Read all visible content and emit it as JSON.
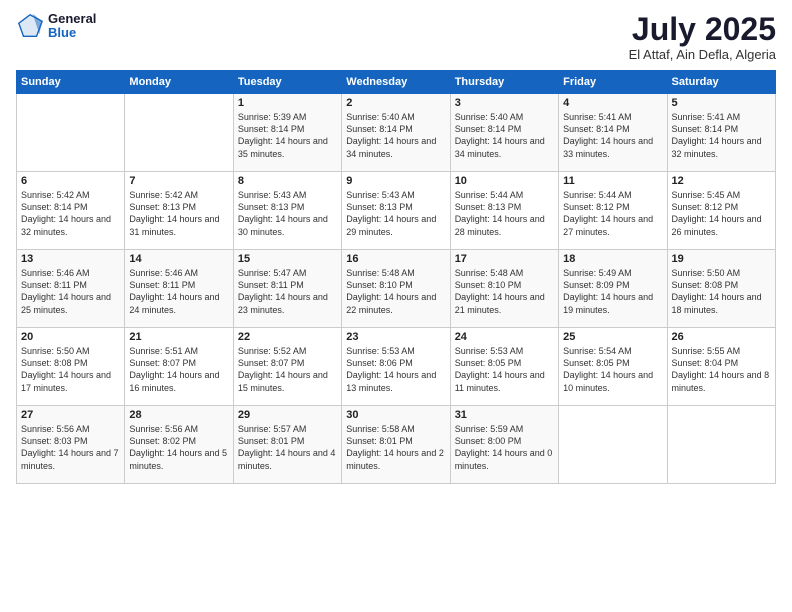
{
  "header": {
    "logo_general": "General",
    "logo_blue": "Blue",
    "month_title": "July 2025",
    "location": "El Attaf, Ain Defla, Algeria"
  },
  "weekdays": [
    "Sunday",
    "Monday",
    "Tuesday",
    "Wednesday",
    "Thursday",
    "Friday",
    "Saturday"
  ],
  "weeks": [
    [
      {
        "day": "",
        "sunrise": "",
        "sunset": "",
        "daylight": ""
      },
      {
        "day": "",
        "sunrise": "",
        "sunset": "",
        "daylight": ""
      },
      {
        "day": "1",
        "sunrise": "Sunrise: 5:39 AM",
        "sunset": "Sunset: 8:14 PM",
        "daylight": "Daylight: 14 hours and 35 minutes."
      },
      {
        "day": "2",
        "sunrise": "Sunrise: 5:40 AM",
        "sunset": "Sunset: 8:14 PM",
        "daylight": "Daylight: 14 hours and 34 minutes."
      },
      {
        "day": "3",
        "sunrise": "Sunrise: 5:40 AM",
        "sunset": "Sunset: 8:14 PM",
        "daylight": "Daylight: 14 hours and 34 minutes."
      },
      {
        "day": "4",
        "sunrise": "Sunrise: 5:41 AM",
        "sunset": "Sunset: 8:14 PM",
        "daylight": "Daylight: 14 hours and 33 minutes."
      },
      {
        "day": "5",
        "sunrise": "Sunrise: 5:41 AM",
        "sunset": "Sunset: 8:14 PM",
        "daylight": "Daylight: 14 hours and 32 minutes."
      }
    ],
    [
      {
        "day": "6",
        "sunrise": "Sunrise: 5:42 AM",
        "sunset": "Sunset: 8:14 PM",
        "daylight": "Daylight: 14 hours and 32 minutes."
      },
      {
        "day": "7",
        "sunrise": "Sunrise: 5:42 AM",
        "sunset": "Sunset: 8:13 PM",
        "daylight": "Daylight: 14 hours and 31 minutes."
      },
      {
        "day": "8",
        "sunrise": "Sunrise: 5:43 AM",
        "sunset": "Sunset: 8:13 PM",
        "daylight": "Daylight: 14 hours and 30 minutes."
      },
      {
        "day": "9",
        "sunrise": "Sunrise: 5:43 AM",
        "sunset": "Sunset: 8:13 PM",
        "daylight": "Daylight: 14 hours and 29 minutes."
      },
      {
        "day": "10",
        "sunrise": "Sunrise: 5:44 AM",
        "sunset": "Sunset: 8:13 PM",
        "daylight": "Daylight: 14 hours and 28 minutes."
      },
      {
        "day": "11",
        "sunrise": "Sunrise: 5:44 AM",
        "sunset": "Sunset: 8:12 PM",
        "daylight": "Daylight: 14 hours and 27 minutes."
      },
      {
        "day": "12",
        "sunrise": "Sunrise: 5:45 AM",
        "sunset": "Sunset: 8:12 PM",
        "daylight": "Daylight: 14 hours and 26 minutes."
      }
    ],
    [
      {
        "day": "13",
        "sunrise": "Sunrise: 5:46 AM",
        "sunset": "Sunset: 8:11 PM",
        "daylight": "Daylight: 14 hours and 25 minutes."
      },
      {
        "day": "14",
        "sunrise": "Sunrise: 5:46 AM",
        "sunset": "Sunset: 8:11 PM",
        "daylight": "Daylight: 14 hours and 24 minutes."
      },
      {
        "day": "15",
        "sunrise": "Sunrise: 5:47 AM",
        "sunset": "Sunset: 8:11 PM",
        "daylight": "Daylight: 14 hours and 23 minutes."
      },
      {
        "day": "16",
        "sunrise": "Sunrise: 5:48 AM",
        "sunset": "Sunset: 8:10 PM",
        "daylight": "Daylight: 14 hours and 22 minutes."
      },
      {
        "day": "17",
        "sunrise": "Sunrise: 5:48 AM",
        "sunset": "Sunset: 8:10 PM",
        "daylight": "Daylight: 14 hours and 21 minutes."
      },
      {
        "day": "18",
        "sunrise": "Sunrise: 5:49 AM",
        "sunset": "Sunset: 8:09 PM",
        "daylight": "Daylight: 14 hours and 19 minutes."
      },
      {
        "day": "19",
        "sunrise": "Sunrise: 5:50 AM",
        "sunset": "Sunset: 8:08 PM",
        "daylight": "Daylight: 14 hours and 18 minutes."
      }
    ],
    [
      {
        "day": "20",
        "sunrise": "Sunrise: 5:50 AM",
        "sunset": "Sunset: 8:08 PM",
        "daylight": "Daylight: 14 hours and 17 minutes."
      },
      {
        "day": "21",
        "sunrise": "Sunrise: 5:51 AM",
        "sunset": "Sunset: 8:07 PM",
        "daylight": "Daylight: 14 hours and 16 minutes."
      },
      {
        "day": "22",
        "sunrise": "Sunrise: 5:52 AM",
        "sunset": "Sunset: 8:07 PM",
        "daylight": "Daylight: 14 hours and 15 minutes."
      },
      {
        "day": "23",
        "sunrise": "Sunrise: 5:53 AM",
        "sunset": "Sunset: 8:06 PM",
        "daylight": "Daylight: 14 hours and 13 minutes."
      },
      {
        "day": "24",
        "sunrise": "Sunrise: 5:53 AM",
        "sunset": "Sunset: 8:05 PM",
        "daylight": "Daylight: 14 hours and 11 minutes."
      },
      {
        "day": "25",
        "sunrise": "Sunrise: 5:54 AM",
        "sunset": "Sunset: 8:05 PM",
        "daylight": "Daylight: 14 hours and 10 minutes."
      },
      {
        "day": "26",
        "sunrise": "Sunrise: 5:55 AM",
        "sunset": "Sunset: 8:04 PM",
        "daylight": "Daylight: 14 hours and 8 minutes."
      }
    ],
    [
      {
        "day": "27",
        "sunrise": "Sunrise: 5:56 AM",
        "sunset": "Sunset: 8:03 PM",
        "daylight": "Daylight: 14 hours and 7 minutes."
      },
      {
        "day": "28",
        "sunrise": "Sunrise: 5:56 AM",
        "sunset": "Sunset: 8:02 PM",
        "daylight": "Daylight: 14 hours and 5 minutes."
      },
      {
        "day": "29",
        "sunrise": "Sunrise: 5:57 AM",
        "sunset": "Sunset: 8:01 PM",
        "daylight": "Daylight: 14 hours and 4 minutes."
      },
      {
        "day": "30",
        "sunrise": "Sunrise: 5:58 AM",
        "sunset": "Sunset: 8:01 PM",
        "daylight": "Daylight: 14 hours and 2 minutes."
      },
      {
        "day": "31",
        "sunrise": "Sunrise: 5:59 AM",
        "sunset": "Sunset: 8:00 PM",
        "daylight": "Daylight: 14 hours and 0 minutes."
      },
      {
        "day": "",
        "sunrise": "",
        "sunset": "",
        "daylight": ""
      },
      {
        "day": "",
        "sunrise": "",
        "sunset": "",
        "daylight": ""
      }
    ]
  ]
}
